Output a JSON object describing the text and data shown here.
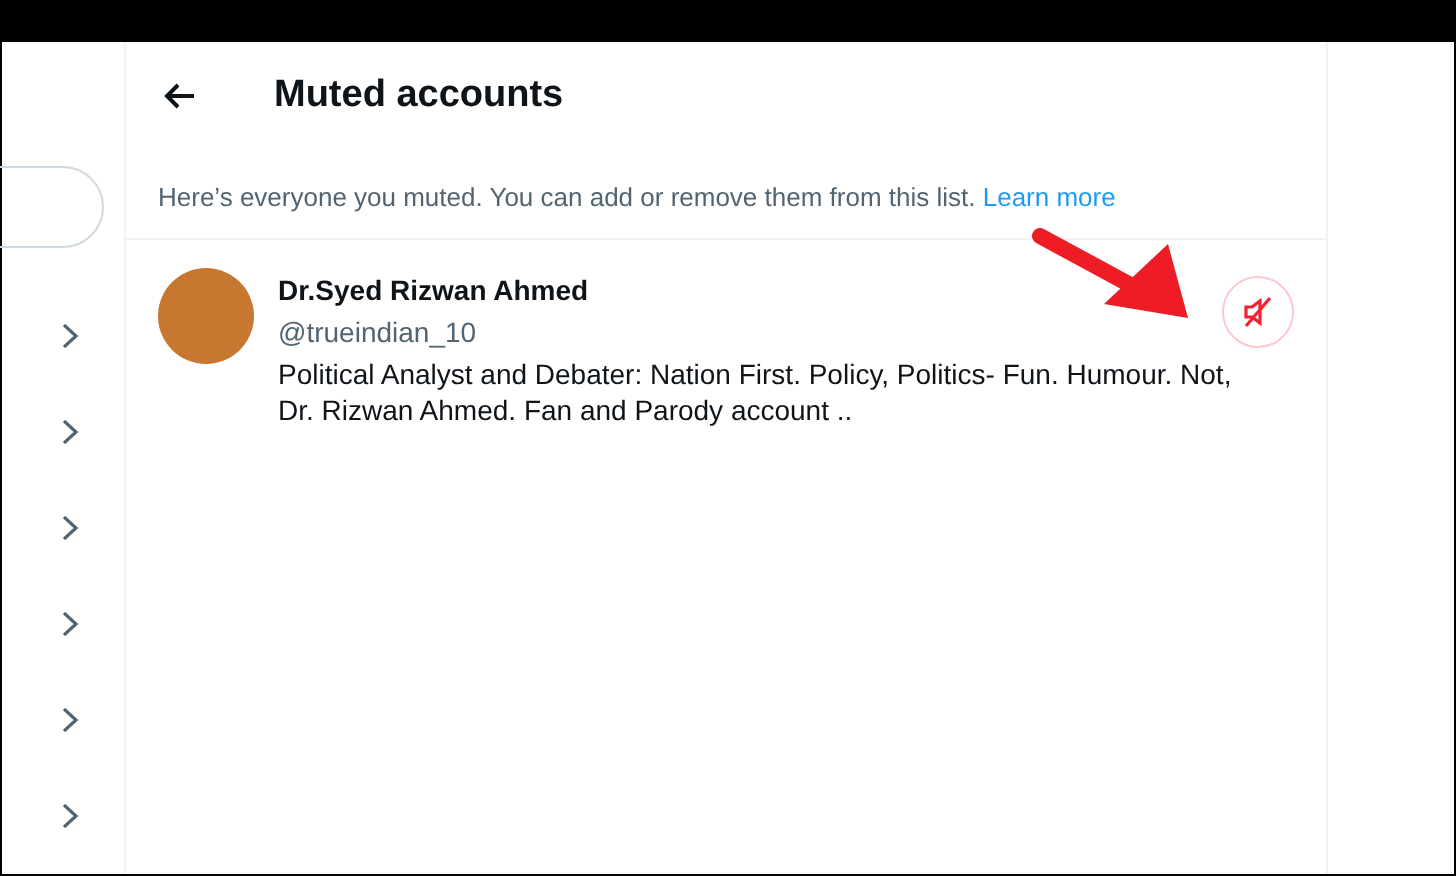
{
  "sidebar": {
    "items": [
      {
        "kind": "chevron"
      },
      {
        "kind": "chevron"
      },
      {
        "kind": "chevron"
      },
      {
        "kind": "chevron"
      },
      {
        "kind": "chevron"
      },
      {
        "kind": "chevron"
      }
    ]
  },
  "header": {
    "title": "Muted accounts"
  },
  "description": {
    "text": "Here’s everyone you muted. You can add or remove them from this list.",
    "link": "Learn more"
  },
  "accounts": [
    {
      "name": "Dr.Syed Rizwan Ahmed",
      "handle": "@trueindian_10",
      "bio": "Political Analyst and Debater: Nation First. Policy, Politics- Fun. Humour. Not, Dr. Rizwan Ahmed. Fan and Parody account ..",
      "muted": true
    }
  ],
  "annotation": {
    "kind": "arrow"
  }
}
